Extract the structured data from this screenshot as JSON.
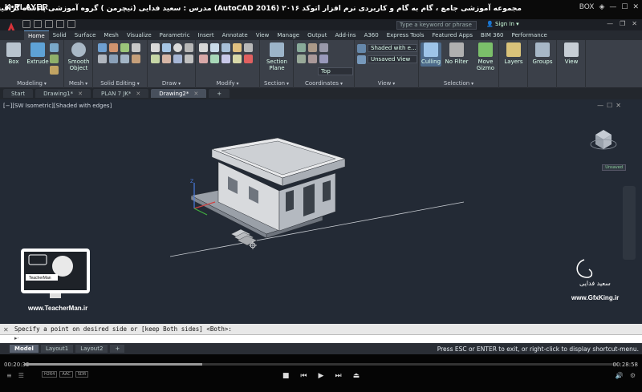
{
  "player": {
    "logo": "K•PLAYER",
    "title": "مجموعه آموزشی جامع ، گام به گام و کاربردی نرم افزار  اتوکد ٢٠١۶  (AutoCAD 2016)  مدرس : سعید فدایی (تیچرمن ) گروه آموزشی پادشاه گرافیست ها",
    "right_label": "BOX",
    "time_current": "00:20:33",
    "time_total": "00:28:58",
    "progress_fraction": 0.3,
    "codec_tags": [
      "H264",
      "AAC",
      "SDR"
    ]
  },
  "acad": {
    "search_placeholder": "Type a keyword or phrase",
    "signin": "Sign In",
    "ribbon_tabs": [
      "Home",
      "Solid",
      "Surface",
      "Mesh",
      "Visualize",
      "Parametric",
      "Insert",
      "Annotate",
      "View",
      "Manage",
      "Output",
      "Add-ins",
      "A360",
      "Express Tools",
      "Featured Apps",
      "BIM 360",
      "Performance"
    ],
    "active_tab": "Home",
    "panels": {
      "modeling": "Modeling",
      "mesh": "Mesh",
      "solid_editing": "Solid Editing",
      "draw": "Draw",
      "modify": "Modify",
      "section": "Section",
      "coordinates": "Coordinates",
      "view": "View",
      "selection": "Selection"
    },
    "buttons": {
      "box": "Box",
      "extrude": "Extrude",
      "smooth_object": "Smooth Object",
      "section_plane": "Section Plane",
      "culling": "Culling",
      "no_filter": "No Filter",
      "move_gizmo": "Move Gizmo",
      "layers": "Layers",
      "groups": "Groups",
      "view": "View"
    },
    "dropdowns": {
      "visual_style": "Shaded with e...",
      "saved_view": "Unsaved View",
      "view_direction": "Top"
    },
    "doc_tabs": [
      "Start",
      "Drawing1*",
      "PLAN 7 JK*",
      "Drawing2*"
    ],
    "active_doc": "Drawing2*",
    "viewport_label": "[−][SW Isometric][Shaded with edges]",
    "unsaved": "Unsaved",
    "command_history": "Specify a point on desired side or [keep Both sides] <Both>:",
    "command_prompt": "▸·",
    "layout_tabs": [
      "Model",
      "Layout1",
      "Layout2"
    ],
    "active_layout": "Model",
    "status_message": "Press ESC or ENTER to exit, or right-click to display shortcut-menu."
  },
  "watermarks": {
    "teacher_brand": "TeacherMan",
    "teacher_url": "www.TeacherMan.ir",
    "gfx_name": "سعید فدایی",
    "gfx_url": "www.GfxKing.ir"
  },
  "colors": {
    "ribbon": "#3b4049",
    "drawing_bg": "#232a35",
    "accent": "#6aa3d8"
  }
}
